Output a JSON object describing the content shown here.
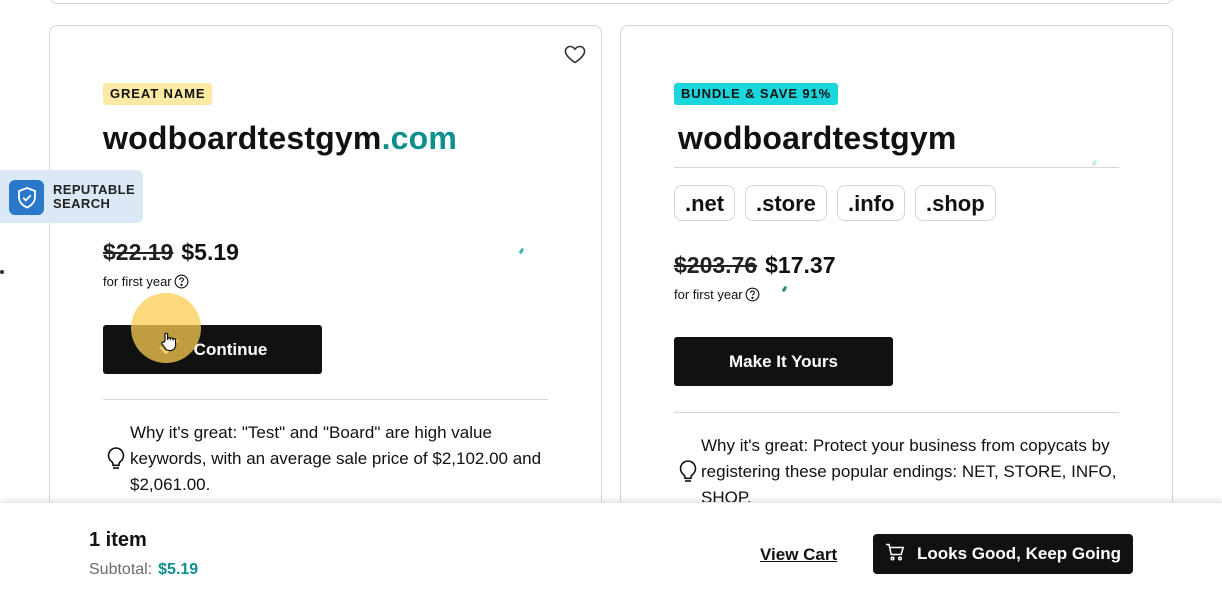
{
  "cards": [
    {
      "tag": "GREAT NAME",
      "domain_name": "wodboardtestgym",
      "domain_tld": ".com",
      "old_price": "$22.19",
      "price": "$5.19",
      "price_note": "for first year",
      "button_label": "Continue",
      "why_text": "Why it's great: \"Test\" and \"Board\" are high value keywords, with an average sale price of $2,102.00 and $2,061.00."
    },
    {
      "tag": "BUNDLE & SAVE 91%",
      "domain_name": "wodboardtestgym",
      "extensions": [
        ".net",
        ".store",
        ".info",
        ".shop"
      ],
      "old_price": "$203.76",
      "price": "$17.37",
      "price_note": "for first year",
      "button_label": "Make It Yours",
      "why_text": "Why it's great: Protect your business from copycats by registering these popular endings: NET, STORE, INFO, SHOP."
    }
  ],
  "badge": {
    "label": "REPUTABLE\nSEARCH",
    "icon": "shield-check-icon"
  },
  "footer": {
    "item_count": "1 item",
    "subtotal_label": "Subtotal:",
    "subtotal_value": "$5.19",
    "view_cart": "View Cart",
    "keep_going": "Looks Good, Keep Going"
  },
  "colors": {
    "accent_teal": "#0c8f8f",
    "great_name_tag": "#fbe9a4",
    "bundle_tag": "#1bd6dd",
    "primary_button": "#111111",
    "badge_bg": "#dbe8f5",
    "shield_blue": "#2a78c9"
  }
}
